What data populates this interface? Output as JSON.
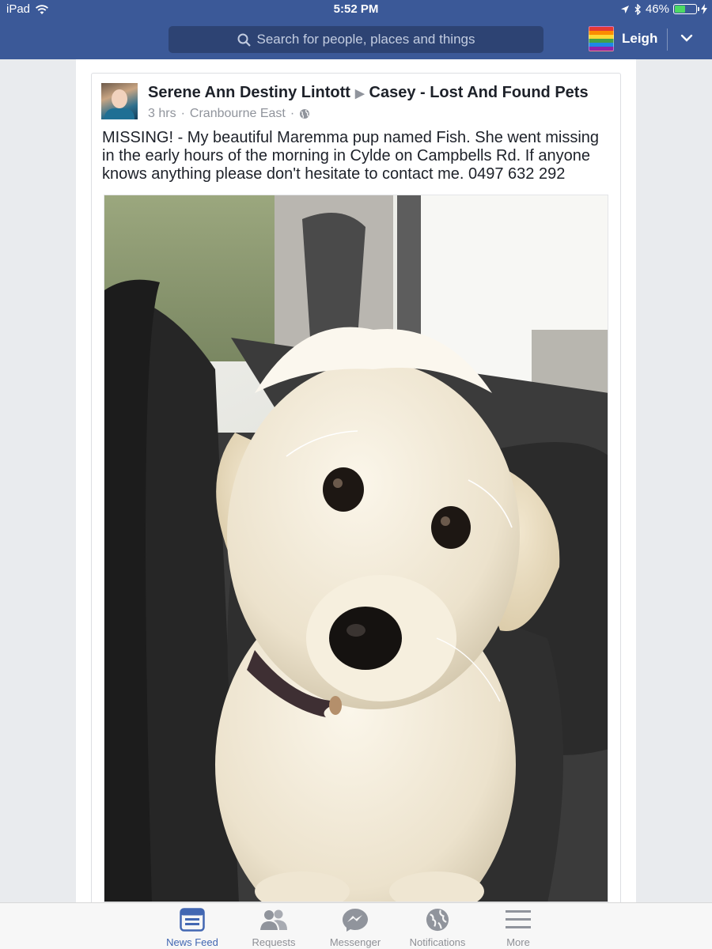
{
  "status_bar": {
    "device": "iPad",
    "time": "5:52 PM",
    "battery": "46%",
    "battery_level": 0.46
  },
  "header": {
    "search_placeholder": "Search for people, places and things",
    "user_name": "Leigh"
  },
  "post": {
    "author": "Serene Ann Destiny Lintott",
    "target": "Casey - Lost And Found Pets",
    "time": "3 hrs",
    "location": "Cranbourne East",
    "text": "MISSING! - My beautiful Maremma pup named Fish. She went missing in the early hours of the morning in Cylde on Campbells Rd. If anyone knows anything please don't hesitate to contact me. 0497 632 292"
  },
  "tabs": [
    {
      "label": "News Feed",
      "icon": "news-feed-icon",
      "active": true
    },
    {
      "label": "Requests",
      "icon": "friend-requests-icon",
      "active": false
    },
    {
      "label": "Messenger",
      "icon": "messenger-icon",
      "active": false
    },
    {
      "label": "Notifications",
      "icon": "globe-icon",
      "active": false
    },
    {
      "label": "More",
      "icon": "menu-icon",
      "active": false
    }
  ],
  "colors": {
    "brand": "#3b5998",
    "active_tab": "#4267b2"
  }
}
